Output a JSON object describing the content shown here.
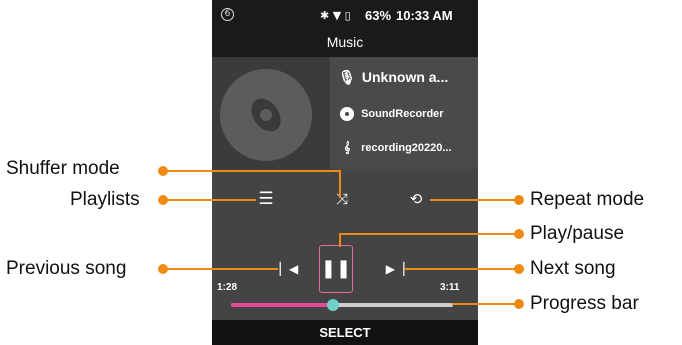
{
  "status_bar": {
    "notification_count": "6",
    "icons": "✱ ▼ ▯",
    "battery": "63%",
    "time": "10:33 AM"
  },
  "app": {
    "title": "Music"
  },
  "track": {
    "artist": "Unknown a...",
    "album": "SoundRecorder",
    "file": "recording20220..."
  },
  "controls": {
    "playlist_icon": "playlist-icon",
    "shuffle_icon": "shuffle-icon",
    "repeat_icon": "repeat-icon",
    "prev_icon": "previous-icon",
    "play_pause_icon": "pause-icon",
    "next_icon": "next-icon"
  },
  "playback": {
    "current_time": "1:28",
    "total_time": "3:11",
    "progress": 0.46
  },
  "softkey": {
    "label": "SELECT"
  },
  "callouts": {
    "shuffle": "Shuffer mode",
    "playlists": "Playlists",
    "repeat": "Repeat mode",
    "play_pause": "Play/pause",
    "previous": "Previous song",
    "next": "Next song",
    "progress": "Progress bar"
  },
  "colors": {
    "accent": "#f08a14",
    "progress_fill": "#e34b93",
    "progress_knob": "#6fd1c7",
    "play_border": "#e26aa2"
  }
}
